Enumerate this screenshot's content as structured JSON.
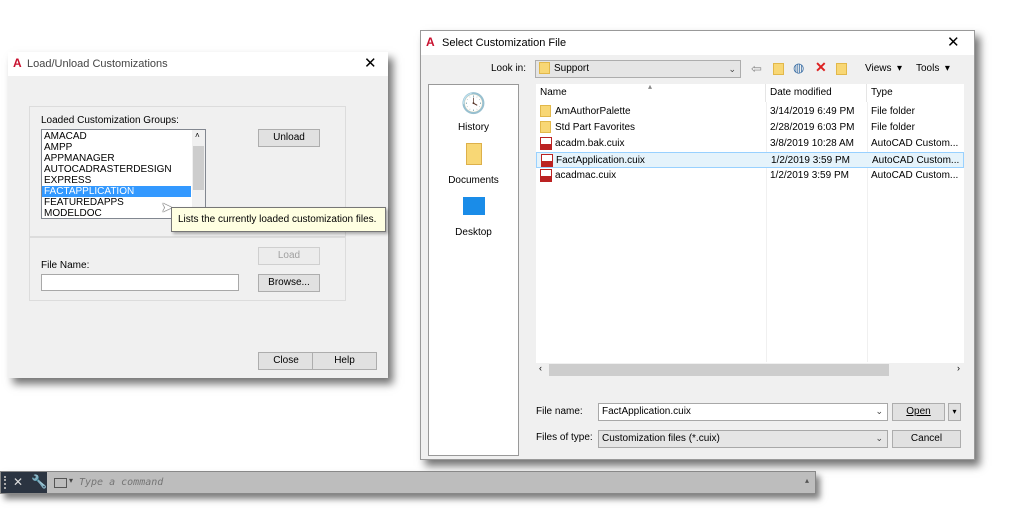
{
  "load_dialog": {
    "title": "Load/Unload Customizations",
    "groups_label": "Loaded Customization Groups:",
    "groups": [
      "AMACAD",
      "AMPP",
      "APPMANAGER",
      "AUTOCADRASTERDESIGN",
      "EXPRESS",
      "FACTAPPLICATION",
      "FEATUREDAPPS",
      "MODELDOC"
    ],
    "selected_group": "FACTAPPLICATION",
    "unload_label": "Unload",
    "load_label": "Load",
    "file_name_label": "File Name:",
    "file_name_value": "",
    "browse_label": "Browse...",
    "close_label": "Close",
    "help_label": "Help",
    "tooltip": "Lists the currently loaded customization files."
  },
  "file_dialog": {
    "title": "Select Customization File",
    "look_in_label": "Look in:",
    "look_in_value": "Support",
    "views_label": "Views",
    "tools_label": "Tools",
    "places": [
      {
        "label": "History",
        "icon": "history-icon"
      },
      {
        "label": "Documents",
        "icon": "documents-icon"
      },
      {
        "label": "Desktop",
        "icon": "desktop-icon"
      }
    ],
    "columns": [
      "Name",
      "Date modified",
      "Type"
    ],
    "files": [
      {
        "name": "AmAuthorPalette",
        "date": "3/14/2019 6:49 PM",
        "type": "File folder",
        "icon": "folder-icon"
      },
      {
        "name": "Std Part Favorites",
        "date": "2/28/2019 6:03 PM",
        "type": "File folder",
        "icon": "folder-icon"
      },
      {
        "name": "acadm.bak.cuix",
        "date": "3/8/2019 10:28 AM",
        "type": "AutoCAD Custom...",
        "icon": "cuix-file-icon"
      },
      {
        "name": "FactApplication.cuix",
        "date": "1/2/2019 3:59 PM",
        "type": "AutoCAD Custom...",
        "icon": "cuix-file-icon"
      },
      {
        "name": "acadmac.cuix",
        "date": "1/2/2019 3:59 PM",
        "type": "AutoCAD Custom...",
        "icon": "cuix-file-icon"
      }
    ],
    "selected_file": "FactApplication.cuix",
    "file_name_label": "File name:",
    "file_name_value": "FactApplication.cuix",
    "files_of_type_label": "Files of type:",
    "files_of_type_value": "Customization files (*.cuix)",
    "open_label": "Open",
    "cancel_label": "Cancel"
  },
  "command_line": {
    "placeholder": "Type a command"
  },
  "colors": {
    "selection": "#3399ff",
    "accent": "#c8102e",
    "tooltip_bg": "#ffffe1"
  }
}
